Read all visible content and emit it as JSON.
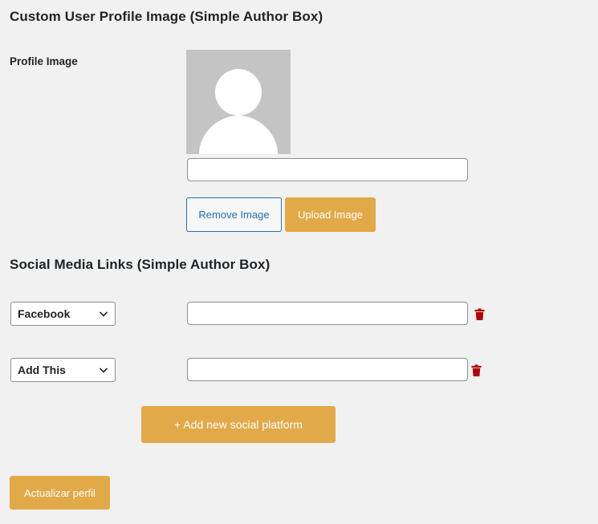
{
  "profile_section": {
    "title": "Custom User Profile Image (Simple Author Box)",
    "profile_image_label": "Profile Image",
    "image_url_value": "",
    "remove_button": "Remove Image",
    "upload_button": "Upload Image"
  },
  "social_section": {
    "title": "Social Media Links (Simple Author Box)",
    "rows": [
      {
        "platform": "Facebook",
        "url_value": ""
      },
      {
        "platform": "Add This",
        "url_value": ""
      }
    ],
    "add_platform_button": "+ Add new social platform"
  },
  "footer": {
    "update_button": "Actualizar perfil"
  },
  "colors": {
    "accent": "#e2a948",
    "secondary_border": "#2271b1",
    "delete_icon": "#b30000",
    "avatar_bg": "#c4c4c4",
    "page_bg": "#f1f1f1"
  }
}
